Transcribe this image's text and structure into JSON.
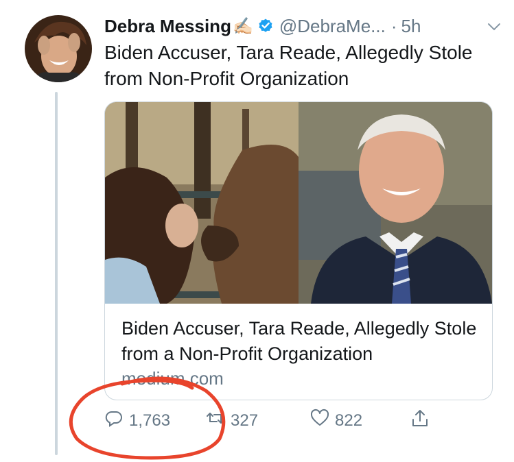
{
  "tweet": {
    "author_name": "Debra Messing",
    "author_emoji": "✍🏻",
    "handle": "@DebraMe...",
    "separator": "·",
    "time": "5h",
    "text": "Biden Accuser, Tara Reade, Allegedly Stole from Non-Profit Organization"
  },
  "card": {
    "title": "Biden Accuser, Tara Reade, Allegedly Stole from a Non-Profit Organization",
    "domain": "medium.com"
  },
  "actions": {
    "replies": "1,763",
    "retweets": "327",
    "likes": "822"
  },
  "icons": [
    "chevron-down-icon",
    "verified-badge-icon",
    "reply-icon",
    "retweet-icon",
    "like-icon",
    "share-icon"
  ],
  "colors": {
    "verified": "#1da1f2",
    "muted": "#657786",
    "annotation": "#e8442c"
  }
}
